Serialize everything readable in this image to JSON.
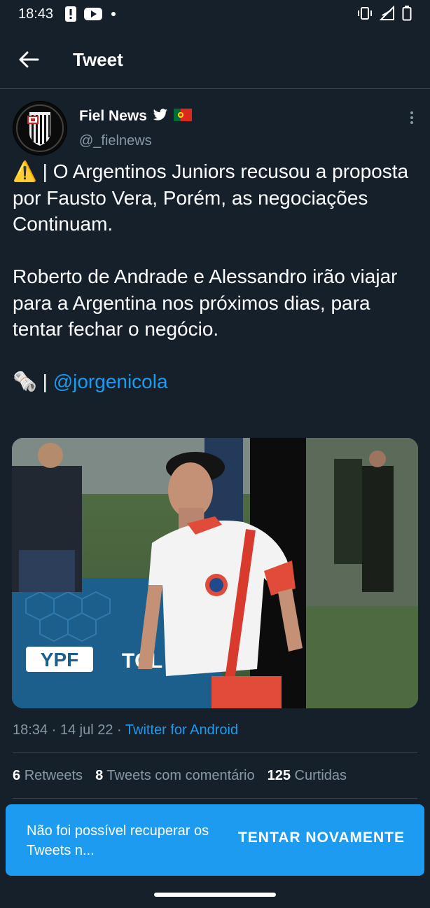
{
  "status_bar": {
    "time": "18:43",
    "left_icons": [
      "alert-icon",
      "youtube-icon",
      "dot-icon"
    ],
    "right_icons": [
      "vibrate-icon",
      "signal-icon",
      "battery-icon"
    ]
  },
  "header": {
    "back_icon": "arrow-left-icon",
    "title": "Tweet"
  },
  "author": {
    "display_name": "Fiel News",
    "handle": "@_fielnews",
    "badges": [
      "twitter-bird-icon",
      "portugal-flag-icon"
    ]
  },
  "tweet": {
    "paragraphs": [
      "⚠️ | O Argentinos Juniors recusou a proposta por Fausto Vera, Porém, as negociações Continuam.",
      "Roberto de Andrade e Alessandro irão viajar para a Argentina nos próximos dias, para tentar fechar o negócio."
    ],
    "source_prefix": "🗞️ | ",
    "mention": "@jorgenicola"
  },
  "media": {
    "billboard_texts": [
      "YPF",
      "TCL"
    ]
  },
  "meta": {
    "time": "18:34",
    "date": "14 jul 22",
    "separator": "·",
    "source": "Twitter for Android"
  },
  "stats": {
    "retweets_count": "6",
    "retweets_label": "Retweets",
    "quotes_count": "8",
    "quotes_label": "Tweets com comentário",
    "likes_count": "125",
    "likes_label": "Curtidas"
  },
  "snackbar": {
    "message": "Não foi possível recuperar os Tweets n...",
    "action": "TENTAR NOVAMENTE"
  },
  "colors": {
    "background": "#15202b",
    "accent": "#1d9bf0",
    "secondary_text": "#8899a6"
  }
}
